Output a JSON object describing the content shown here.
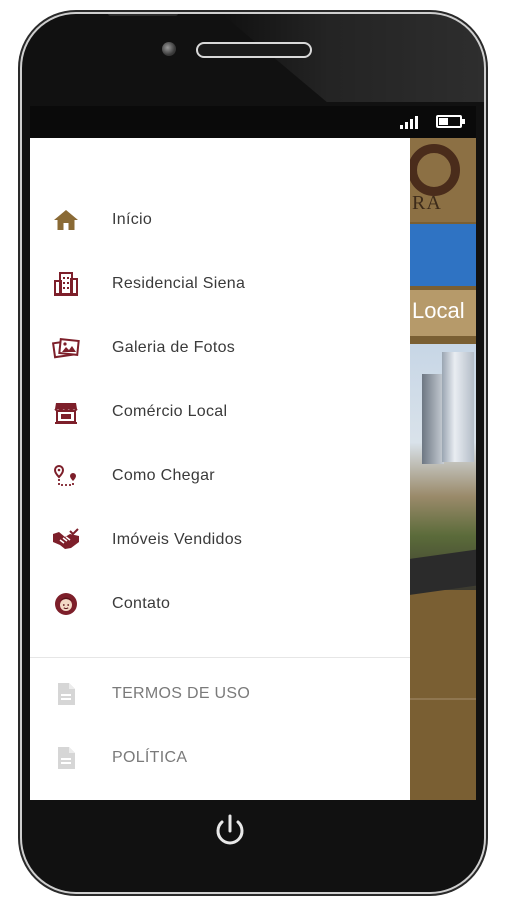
{
  "menu": {
    "items": [
      {
        "label": "Início",
        "icon": "home-icon"
      },
      {
        "label": "Residencial Siena",
        "icon": "building-icon"
      },
      {
        "label": "Galeria de Fotos",
        "icon": "photo-gallery-icon"
      },
      {
        "label": "Comércio Local",
        "icon": "store-icon"
      },
      {
        "label": "Como Chegar",
        "icon": "route-icon"
      },
      {
        "label": "Imóveis Vendidos",
        "icon": "handshake-icon"
      },
      {
        "label": "Contato",
        "icon": "contact-icon"
      }
    ],
    "secondary": [
      {
        "label": "TERMOS DE USO",
        "icon": "document-icon"
      },
      {
        "label": "POLÍTICA",
        "icon": "document-icon"
      }
    ]
  },
  "background": {
    "logo_fragment": "RA",
    "local_fragment": "Local"
  },
  "colors": {
    "icon_primary": "#7d1f2a",
    "icon_home": "#8a6a35",
    "icon_secondary": "#d6d6d6",
    "app_brown": "#7a5f33",
    "app_blue": "#2f73c3"
  }
}
